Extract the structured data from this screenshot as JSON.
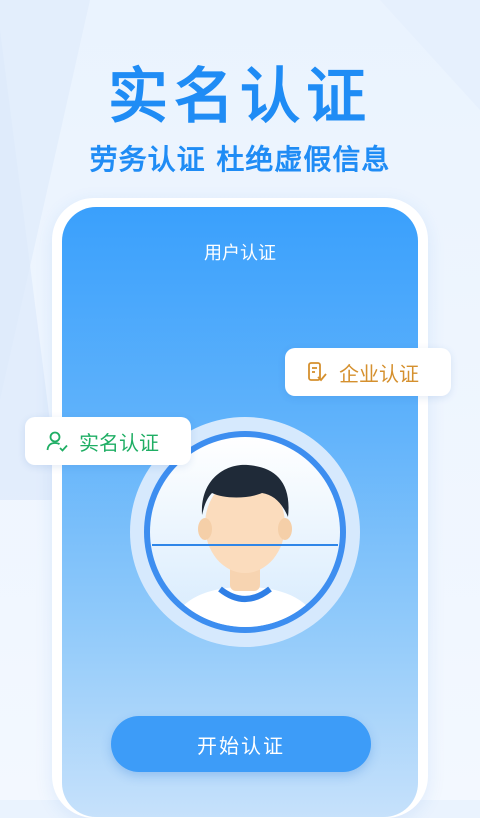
{
  "headline": "实名认证",
  "subheadline": "劳务认证 杜绝虚假信息",
  "screen": {
    "title": "用户认证",
    "badges": {
      "enterprise_label": "企业认证",
      "realname_label": "实名认证"
    },
    "start_button_label": "开始认证"
  },
  "icons": {
    "enterprise": "building-check-icon",
    "realname": "user-check-icon"
  },
  "colors": {
    "accent": "#1f8cf5",
    "button": "#3d9cf8",
    "enterprise_text": "#d5902e",
    "realname_text": "#1fae64"
  }
}
